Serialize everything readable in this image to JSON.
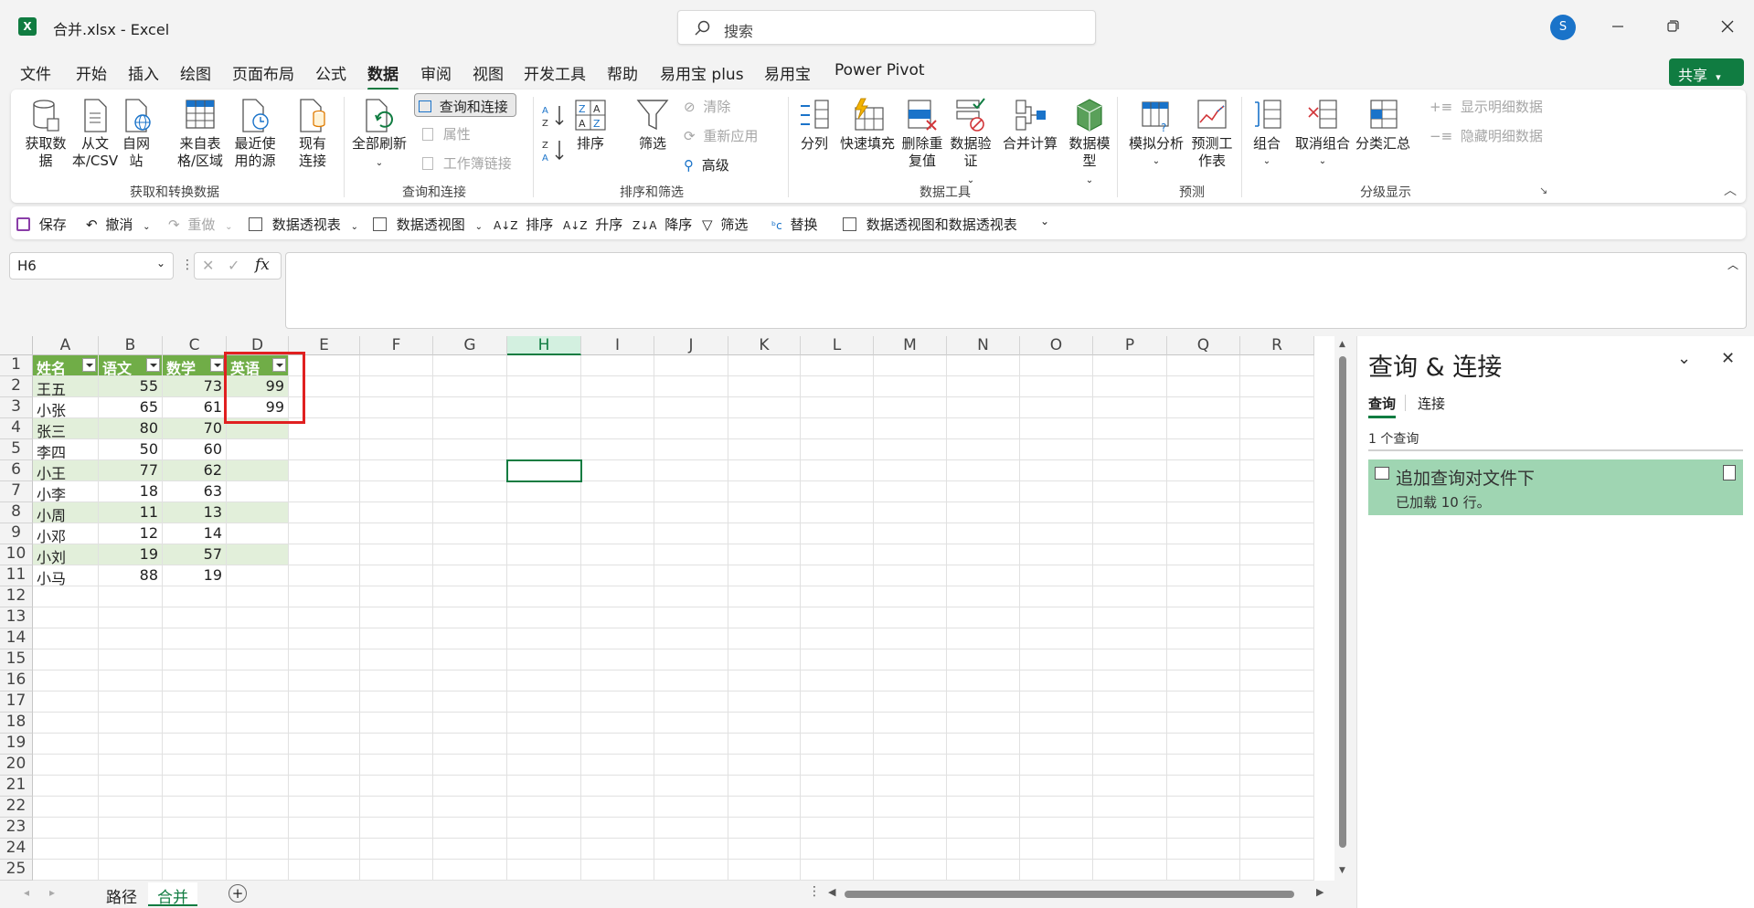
{
  "app": {
    "document_title": "合并.xlsx  -  Excel",
    "logo_letter": "X",
    "search_placeholder": "搜索",
    "user_initial": "S"
  },
  "menu": {
    "tabs": [
      "文件",
      "开始",
      "插入",
      "绘图",
      "页面布局",
      "公式",
      "数据",
      "审阅",
      "视图",
      "开发工具",
      "帮助",
      "易用宝 plus",
      "易用宝",
      "Power Pivot"
    ],
    "active_tab": "数据",
    "share_label": "共享"
  },
  "ribbon": {
    "get_data": "获取数据",
    "from_text": "从文本/CSV",
    "from_web": "自网站",
    "from_table": "来自表格/区域",
    "recent_sources": "最近使用的源",
    "existing_connections": "现有连接",
    "group_get_transform": "获取和转换数据",
    "refresh_all": "全部刷新",
    "queries_connections": "查询和连接",
    "properties": "属性",
    "workbook_links": "工作簿链接",
    "group_queries": "查询和连接",
    "sort": "排序",
    "filter": "筛选",
    "clear": "清除",
    "reapply": "重新应用",
    "advanced": "高级",
    "group_sort_filter": "排序和筛选",
    "text_to_columns": "分列",
    "flash_fill": "快速填充",
    "remove_duplicates": "删除重复值",
    "data_validation": "数据验证",
    "consolidate": "合并计算",
    "data_model": "数据模型",
    "group_data_tools": "数据工具",
    "what_if": "模拟分析",
    "forecast_sheet": "预测工作表",
    "group_forecast": "预测",
    "group": "组合",
    "ungroup": "取消组合",
    "subtotal": "分类汇总",
    "show_detail": "显示明细数据",
    "hide_detail": "隐藏明细数据",
    "group_outline": "分级显示"
  },
  "qat": {
    "save": "保存",
    "undo": "撤消",
    "redo": "重做",
    "pivot_table": "数据透视表",
    "pivot_chart": "数据透视图",
    "sort": "排序",
    "sort_asc": "升序",
    "sort_desc": "降序",
    "filter": "筛选",
    "replace": "替换",
    "pivot_chart_table": "数据透视图和数据透视表"
  },
  "formula_bar": {
    "name_box": "H6",
    "fx": "fx",
    "formula": ""
  },
  "grid": {
    "columns": [
      "A",
      "B",
      "C",
      "D",
      "E",
      "F",
      "G",
      "H",
      "I",
      "J",
      "K",
      "L",
      "M",
      "N",
      "O",
      "P",
      "Q",
      "R"
    ],
    "selected_column": "H",
    "row_numbers": [
      "1",
      "2",
      "3",
      "4",
      "5",
      "6",
      "7",
      "8",
      "9",
      "10",
      "11",
      "12",
      "13",
      "14",
      "15",
      "16",
      "17",
      "18",
      "19",
      "20",
      "21",
      "22",
      "23",
      "24",
      "25"
    ],
    "table_headers": [
      "姓名",
      "语文",
      "数学",
      "英语"
    ],
    "table_rows": [
      [
        "王五",
        "55",
        "73",
        "99"
      ],
      [
        "小张",
        "65",
        "61",
        "99"
      ],
      [
        "张三",
        "80",
        "70",
        ""
      ],
      [
        "李四",
        "50",
        "60",
        ""
      ],
      [
        "小王",
        "77",
        "62",
        ""
      ],
      [
        "小李",
        "18",
        "63",
        ""
      ],
      [
        "小周",
        "11",
        "13",
        ""
      ],
      [
        "小邓",
        "12",
        "14",
        ""
      ],
      [
        "小刘",
        "19",
        "57",
        ""
      ],
      [
        "小马",
        "88",
        "19",
        ""
      ]
    ],
    "active_cell": "H6"
  },
  "sheets": {
    "tabs": [
      "路径",
      "合并"
    ],
    "active": "合并"
  },
  "queries_pane": {
    "title": "查询 & 连接",
    "tabs": [
      "查询",
      "连接"
    ],
    "active_tab": "查询",
    "count_text": "1 个查询",
    "items": [
      {
        "name": "追加查询对文件下",
        "status": "已加载 10 行。"
      }
    ]
  },
  "colors": {
    "accent": "#107c41",
    "table_header": "#70ad47",
    "table_band": "#e2efda",
    "highlight_box": "#e02020",
    "query_item_bg": "#9fd5b2"
  }
}
